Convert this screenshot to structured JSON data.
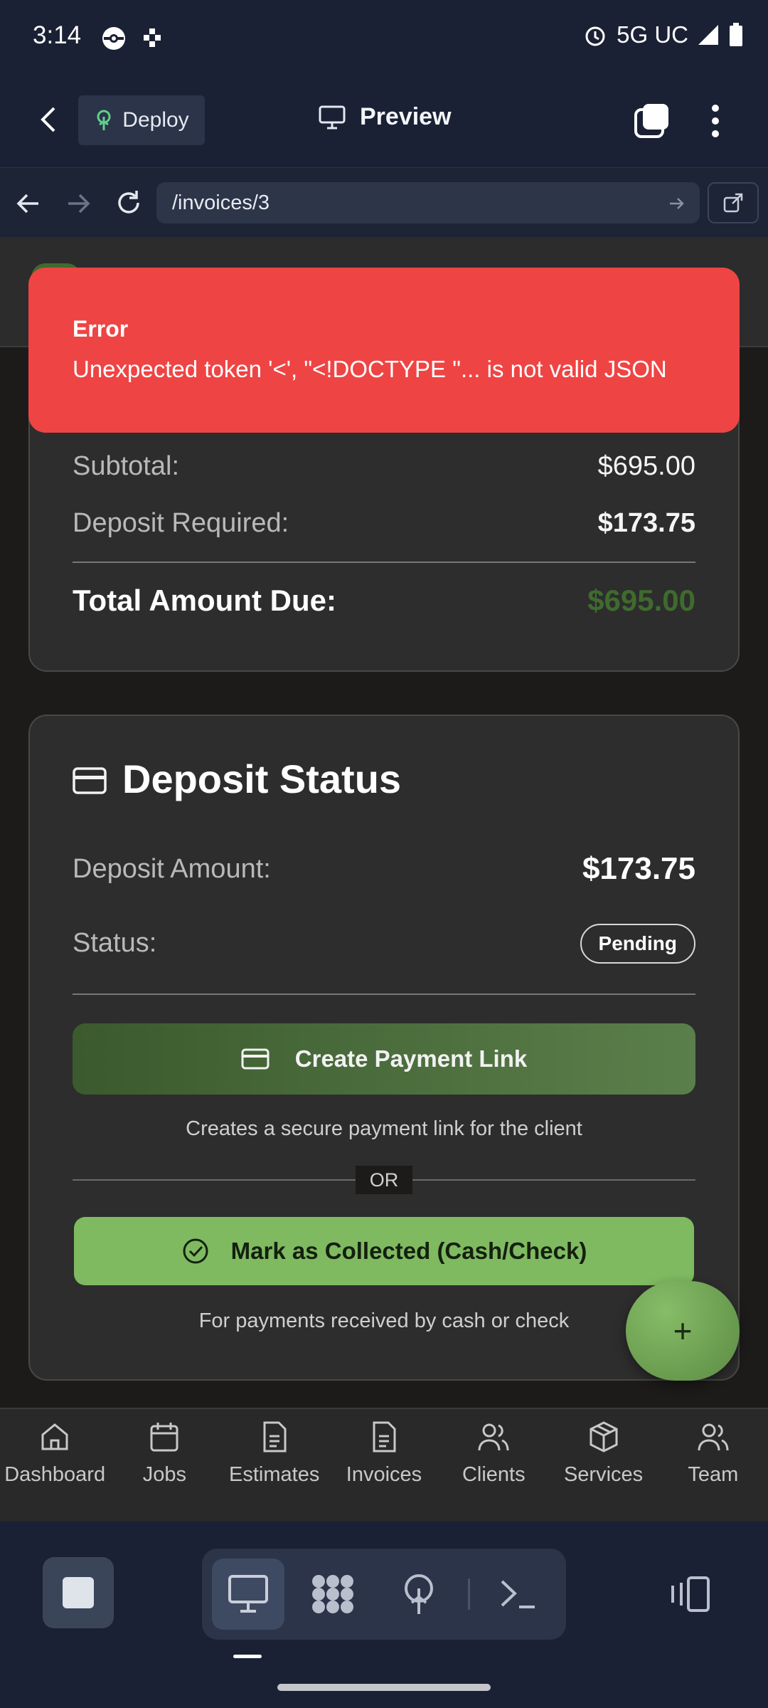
{
  "status_bar": {
    "time": "3:14",
    "network": "5G UC"
  },
  "header": {
    "deploy_label": "Deploy",
    "preview_label": "Preview"
  },
  "browser": {
    "url": "/invoices/3"
  },
  "toast": {
    "title": "Error",
    "message": "Unexpected token '<', \"<!DOCTYPE \"... is not valid JSON"
  },
  "totals": {
    "subtotal_label": "Subtotal:",
    "subtotal_value": "$695.00",
    "deposit_label": "Deposit Required:",
    "deposit_value": "$173.75",
    "total_label": "Total Amount Due:",
    "total_value": "$695.00"
  },
  "deposit": {
    "title": "Deposit Status",
    "amount_label": "Deposit Amount:",
    "amount_value": "$173.75",
    "status_label": "Status:",
    "status_value": "Pending",
    "create_link_label": "Create Payment Link",
    "create_link_hint": "Creates a secure payment link for the client",
    "or_label": "OR",
    "collected_label": "Mark as Collected (Cash/Check)",
    "collected_hint": "For payments received by cash or check"
  },
  "fab": {
    "label": "+"
  },
  "tabs": [
    {
      "label": "Dashboard",
      "icon": "home-icon"
    },
    {
      "label": "Jobs",
      "icon": "calendar-icon"
    },
    {
      "label": "Estimates",
      "icon": "document-icon"
    },
    {
      "label": "Invoices",
      "icon": "document-icon"
    },
    {
      "label": "Clients",
      "icon": "users-icon"
    },
    {
      "label": "Services",
      "icon": "package-icon"
    },
    {
      "label": "Team",
      "icon": "users-icon"
    }
  ],
  "colors": {
    "accent_green": "#7fba61",
    "error_red": "#ef4444",
    "total_green": "#3f6b2e"
  }
}
